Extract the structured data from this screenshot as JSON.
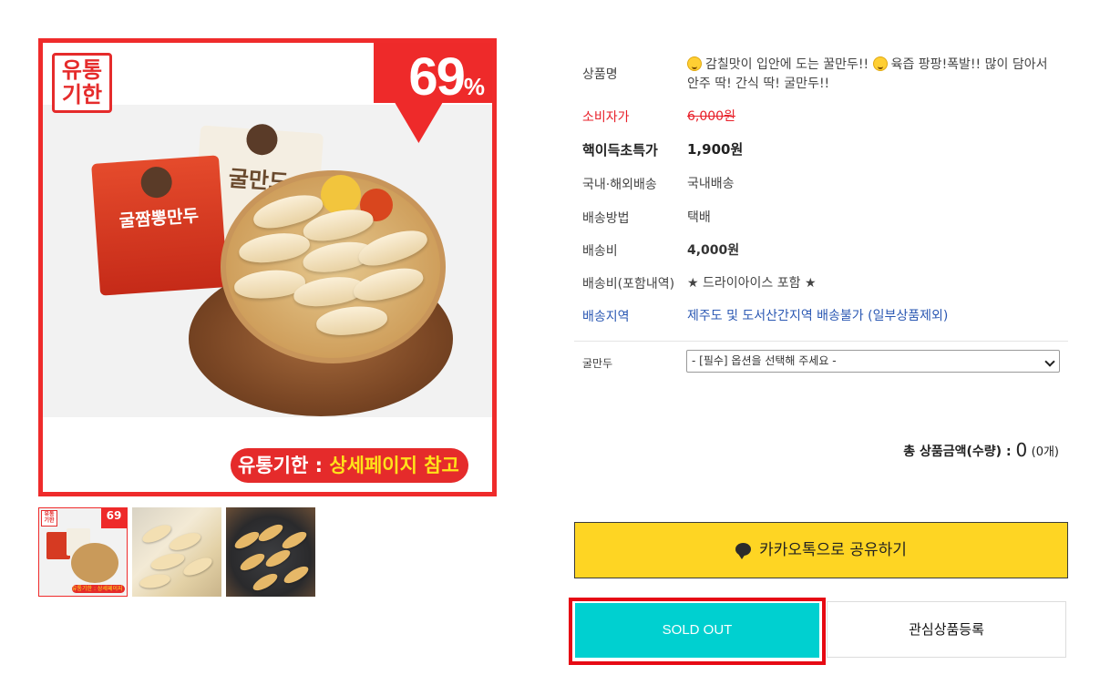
{
  "image": {
    "stamp_text": "유통\n기한",
    "discount_badge": "69",
    "discount_unit": "%",
    "package_red_text": "굴짬뽕만두",
    "package_cream_text": "굴만드",
    "ribbon_prefix": "유통기한 : ",
    "ribbon_highlight": "상세페이지 참고",
    "thumb_badge": "69",
    "thumb_ribbon": "유통기한 : 상세페이지 참고"
  },
  "product": {
    "rows": [
      {
        "label": "상품명",
        "value": "감칠맛이 입안에 도는 꿀만두!! 육즙 팡팡!폭발!! 많이 담아서 안주 딱! 간식 딱! 굴만두!!",
        "value_part1": "감칠맛이 입안에 도는 꿀만두!! ",
        "value_part2": "육즙 팡팡!폭발!! 많이 담아서 안주 딱! 간식 딱! 굴만두!!"
      },
      {
        "label": "소비자가",
        "value": "6,000원"
      },
      {
        "label": "핵이득초특가",
        "value": "1,900원"
      },
      {
        "label": "국내·해외배송",
        "value": "국내배송"
      },
      {
        "label": "배송방법",
        "value": "택배"
      },
      {
        "label": "배송비",
        "value": "4,000원"
      },
      {
        "label": "배송비(포함내역)",
        "value": "★ 드라이아이스 포함 ★"
      },
      {
        "label": "배송지역",
        "value": "제주도 및 도서산간지역 배송불가 (일부상품제외)"
      }
    ]
  },
  "option": {
    "label": "굴만두",
    "selected": "- [필수] 옵션을 선택해 주세요 -"
  },
  "total": {
    "label": "총 상품금액(수량) : ",
    "amount": "0",
    "count": "(0개)"
  },
  "buttons": {
    "kakao_label": "카카오톡으로 공유하기",
    "soldout_label": "SOLD OUT",
    "wish_label": "관심상품등록"
  },
  "colors": {
    "accent_red": "#e8202a",
    "kakao_yellow": "#fed523",
    "soldout_cyan": "#00d0d0",
    "link_blue": "#2b58b3"
  },
  "icons": [
    "smiley-emoji-icon",
    "kakao-chat-bubble-icon",
    "chevron-down-icon"
  ]
}
